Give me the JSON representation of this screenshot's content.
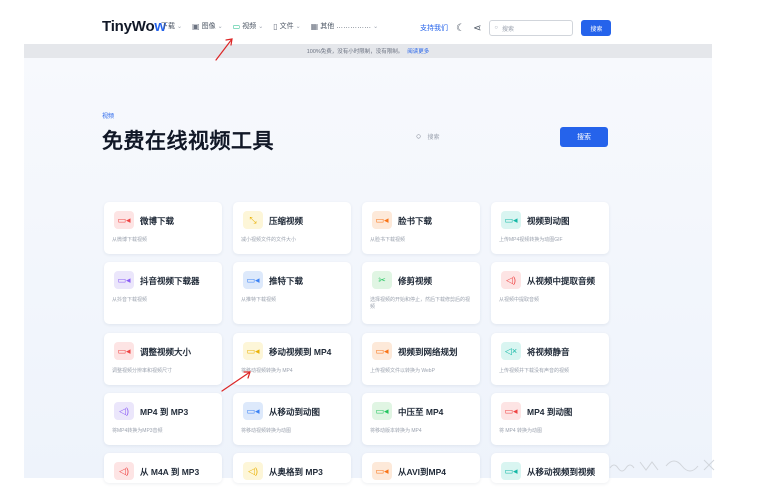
{
  "brand": {
    "logo_main": "TinyWo",
    "logo_accent": "w"
  },
  "nav": {
    "items": [
      {
        "label": "下载",
        "icon": "download-icon"
      },
      {
        "label": "图像",
        "icon": "image-icon"
      },
      {
        "label": "视频",
        "icon": "video-icon"
      },
      {
        "label": "文件",
        "icon": "file-icon"
      },
      {
        "label": "其他 ……………",
        "icon": "grid-icon"
      }
    ],
    "support_label": "支持我们",
    "search_placeholder": "搜索",
    "search_button": "搜索"
  },
  "notice": {
    "text": "100%免费，没有小时限制，没有限制。",
    "link": "阅读更多"
  },
  "hero": {
    "breadcrumb": "视频",
    "title": "免费在线视频工具",
    "search_placeholder": "搜索",
    "search_button": "搜索"
  },
  "tools": [
    {
      "name": "微博下载",
      "desc": "从微博下载视频"
    },
    {
      "name": "压缩视频",
      "desc": "减小视频文件的文件大小"
    },
    {
      "name": "脸书下载",
      "desc": "从脸书下载视频"
    },
    {
      "name": "视频到动图",
      "desc": "上传MP4视频转换为动图GIF"
    },
    {
      "name": "抖音视频下载器",
      "desc": "从抖音下载视频"
    },
    {
      "name": "推特下载",
      "desc": "从推特下载视频"
    },
    {
      "name": "修剪视频",
      "desc": "选择视频的开始和停止，然后下载修剪后的视频"
    },
    {
      "name": "从视频中提取音频",
      "desc": "从视频中提取音频"
    },
    {
      "name": "调整视频大小",
      "desc": "调整视频分辨率和视频尺寸"
    },
    {
      "name": "移动视频到 MP4",
      "desc": "将移动视频转换为 MP4"
    },
    {
      "name": "视频到网络规划",
      "desc": "上传视频文件以转换为 WebP"
    },
    {
      "name": "将视频静音",
      "desc": "上传视频并下载没有声音的视频"
    },
    {
      "name": "MP4 到 MP3",
      "desc": "将MP4转换为MP3音频"
    },
    {
      "name": "从移动到动图",
      "desc": "将移动视频转换为动图"
    },
    {
      "name": "中压至 MP4",
      "desc": "将移动版本转换为 MP4"
    },
    {
      "name": "MP4 到动图",
      "desc": "将 MP4 转换为动图"
    },
    {
      "name": "从 M4A 到 MP3",
      "desc": ""
    },
    {
      "name": "从奥格到 MP3",
      "desc": ""
    },
    {
      "name": "从AVI到MP4",
      "desc": ""
    },
    {
      "name": "从移动视频到视频",
      "desc": ""
    }
  ],
  "colors": {
    "accent": "#2563eb",
    "annotation": "#dc2626"
  }
}
